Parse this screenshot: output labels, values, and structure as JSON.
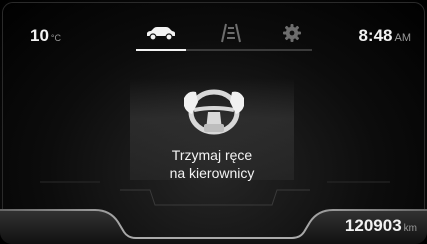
{
  "status": {
    "temperature": "10",
    "temperature_unit": "°C",
    "time": "8:48",
    "time_suffix": "AM"
  },
  "tabs": [
    {
      "id": "vehicle",
      "icon": "car-icon",
      "active": true
    },
    {
      "id": "lane",
      "icon": "lane-assist-icon",
      "active": false
    },
    {
      "id": "settings",
      "icon": "gear-icon",
      "active": false
    }
  ],
  "alert": {
    "icon": "hands-on-wheel-icon",
    "line1": "Trzymaj ręce",
    "line2": "na kierownicy"
  },
  "odometer": {
    "value": "120903",
    "unit": "km"
  },
  "colors": {
    "text": "#f2f2f2",
    "muted": "#9a9a9a",
    "background": "#000000"
  }
}
